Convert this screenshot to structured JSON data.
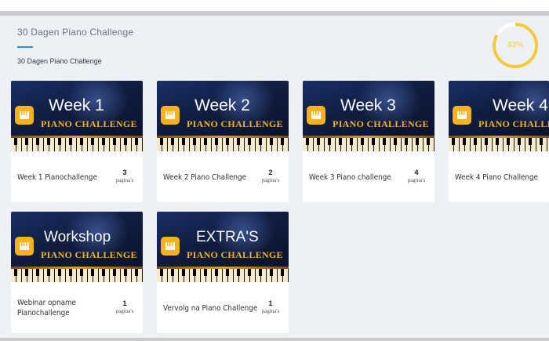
{
  "header": {
    "course_title": "30 Dagen Piano Challenge",
    "breadcrumb": "30 Dagen Piano Challenge",
    "progress_label": "83%",
    "progress_value": 0.83,
    "accent_color": "#2f8ad8",
    "progress_color": "#f4c93a"
  },
  "cards": [
    {
      "thumb_title": "Week 1",
      "thumb_subtitle": "PIANO CHALLENGE",
      "name": "Week 1 Pianochallenge",
      "count": "3",
      "unit": "pagina's"
    },
    {
      "thumb_title": "Week 2",
      "thumb_subtitle": "PIANO CHALLENGE",
      "name": "Week 2 Piano Challenge",
      "count": "2",
      "unit": "pagina's"
    },
    {
      "thumb_title": "Week 3",
      "thumb_subtitle": "PIANO CHALLENGE",
      "name": "Week 3 Piano challenge",
      "count": "4",
      "unit": "pagina's"
    },
    {
      "thumb_title": "Week 4",
      "thumb_subtitle": "PIANO CHALLENGE",
      "name": "Week 4 Piano Challenge",
      "count": "",
      "unit": ""
    },
    {
      "thumb_title": "Workshop",
      "thumb_subtitle": "PIANO CHALLENGE",
      "name": "Webinar opname Pianochallenge",
      "count": "1",
      "unit": "pagina's"
    },
    {
      "thumb_title": "EXTRA'S",
      "thumb_subtitle": "PIANO CHALLENGE",
      "name": "Vervolg na Piano Challenge",
      "count": "1",
      "unit": "pagina's"
    }
  ]
}
